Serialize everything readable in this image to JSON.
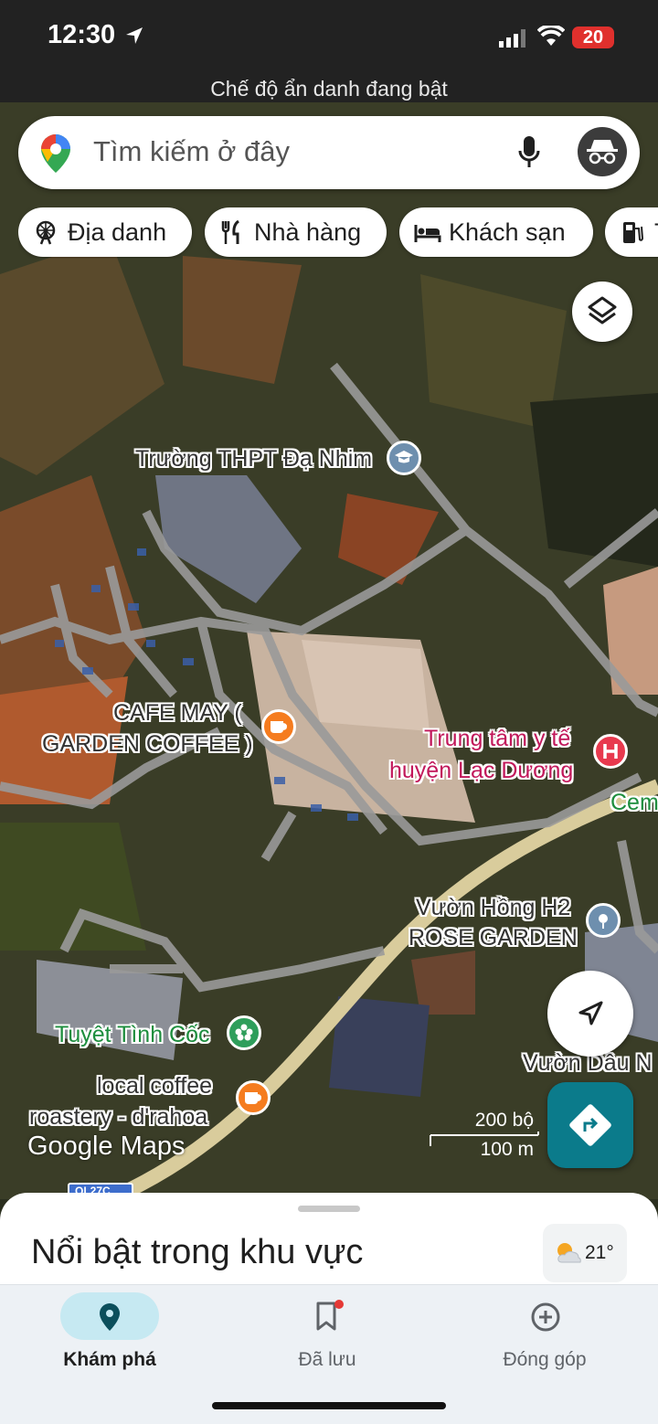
{
  "status_bar": {
    "time": "12:30",
    "battery": "20"
  },
  "incognito_banner": "Chế độ ẩn danh đang bật",
  "search": {
    "placeholder": "Tìm kiếm ở đây"
  },
  "chips": [
    {
      "label": "Địa danh",
      "icon": "ferris-wheel-icon"
    },
    {
      "label": "Nhà hàng",
      "icon": "fork-knife-icon"
    },
    {
      "label": "Khách sạn",
      "icon": "bed-icon"
    },
    {
      "label": "T",
      "icon": "gas-station-icon"
    }
  ],
  "map_labels": {
    "school": "Trường THPT Đạ Nhim",
    "cafe_may_1": "CAFE MAY (",
    "cafe_may_2": "GARDEN COFFEE )",
    "medical_1": "Trung tâm y tế",
    "medical_2": "huyện Lạc Dương",
    "cem": "Cem",
    "rose_1": "Vườn Hồng H2",
    "rose_2": "ROSE GARDEN",
    "tuyet_tinh_coc": "Tuyệt Tình Cốc",
    "local_coffee_1": "local coffee",
    "local_coffee_2": "roastery - d'rahoa",
    "vuon_dau": "Vườn Dâu N",
    "road_badge": "QL27C"
  },
  "scale": {
    "imperial": "200 bộ",
    "metric": "100 m"
  },
  "logo": "Google Maps",
  "sheet": {
    "title": "Nổi bật trong khu vực",
    "temperature": "21°"
  },
  "nav": [
    {
      "label": "Khám phá",
      "icon": "explore-pin-icon",
      "active": true
    },
    {
      "label": "Đã lưu",
      "icon": "bookmark-icon",
      "active": false
    },
    {
      "label": "Đóng góp",
      "icon": "add-circle-icon",
      "active": false
    }
  ],
  "colors": {
    "accent": "#0b7b8b",
    "hospital": "#e8394e",
    "cafe": "#f57c1f",
    "park": "#2e9e5b"
  }
}
